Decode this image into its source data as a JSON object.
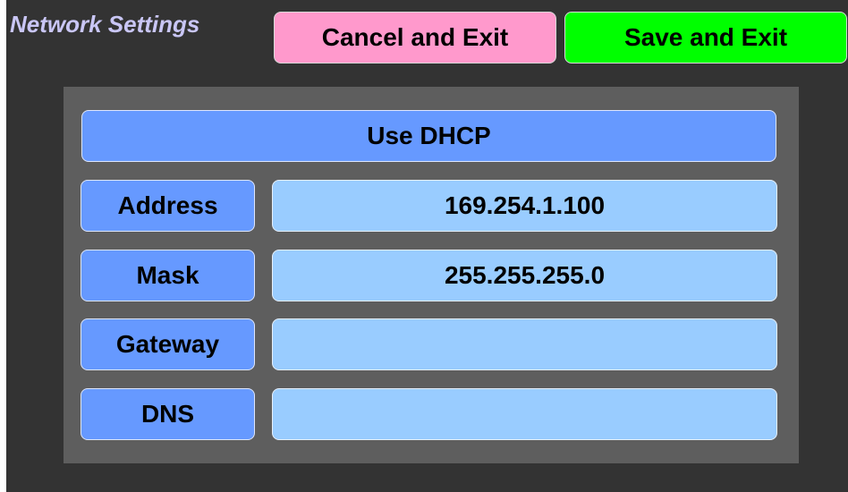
{
  "header": {
    "title": "Network Settings",
    "cancel_label": "Cancel and Exit",
    "save_label": "Save and Exit"
  },
  "panel": {
    "dhcp_label": "Use DHCP",
    "rows": [
      {
        "label": "Address",
        "value": "169.254.1.100"
      },
      {
        "label": "Mask",
        "value": "255.255.255.0"
      },
      {
        "label": "Gateway",
        "value": ""
      },
      {
        "label": "DNS",
        "value": ""
      }
    ]
  },
  "colors": {
    "background": "#333333",
    "panel": "#5e5e5e",
    "title": "#c9c6f5",
    "cancel_button": "#ff99cc",
    "save_button": "#00ff00",
    "label_button": "#6699ff",
    "value_field": "#99ccff"
  }
}
